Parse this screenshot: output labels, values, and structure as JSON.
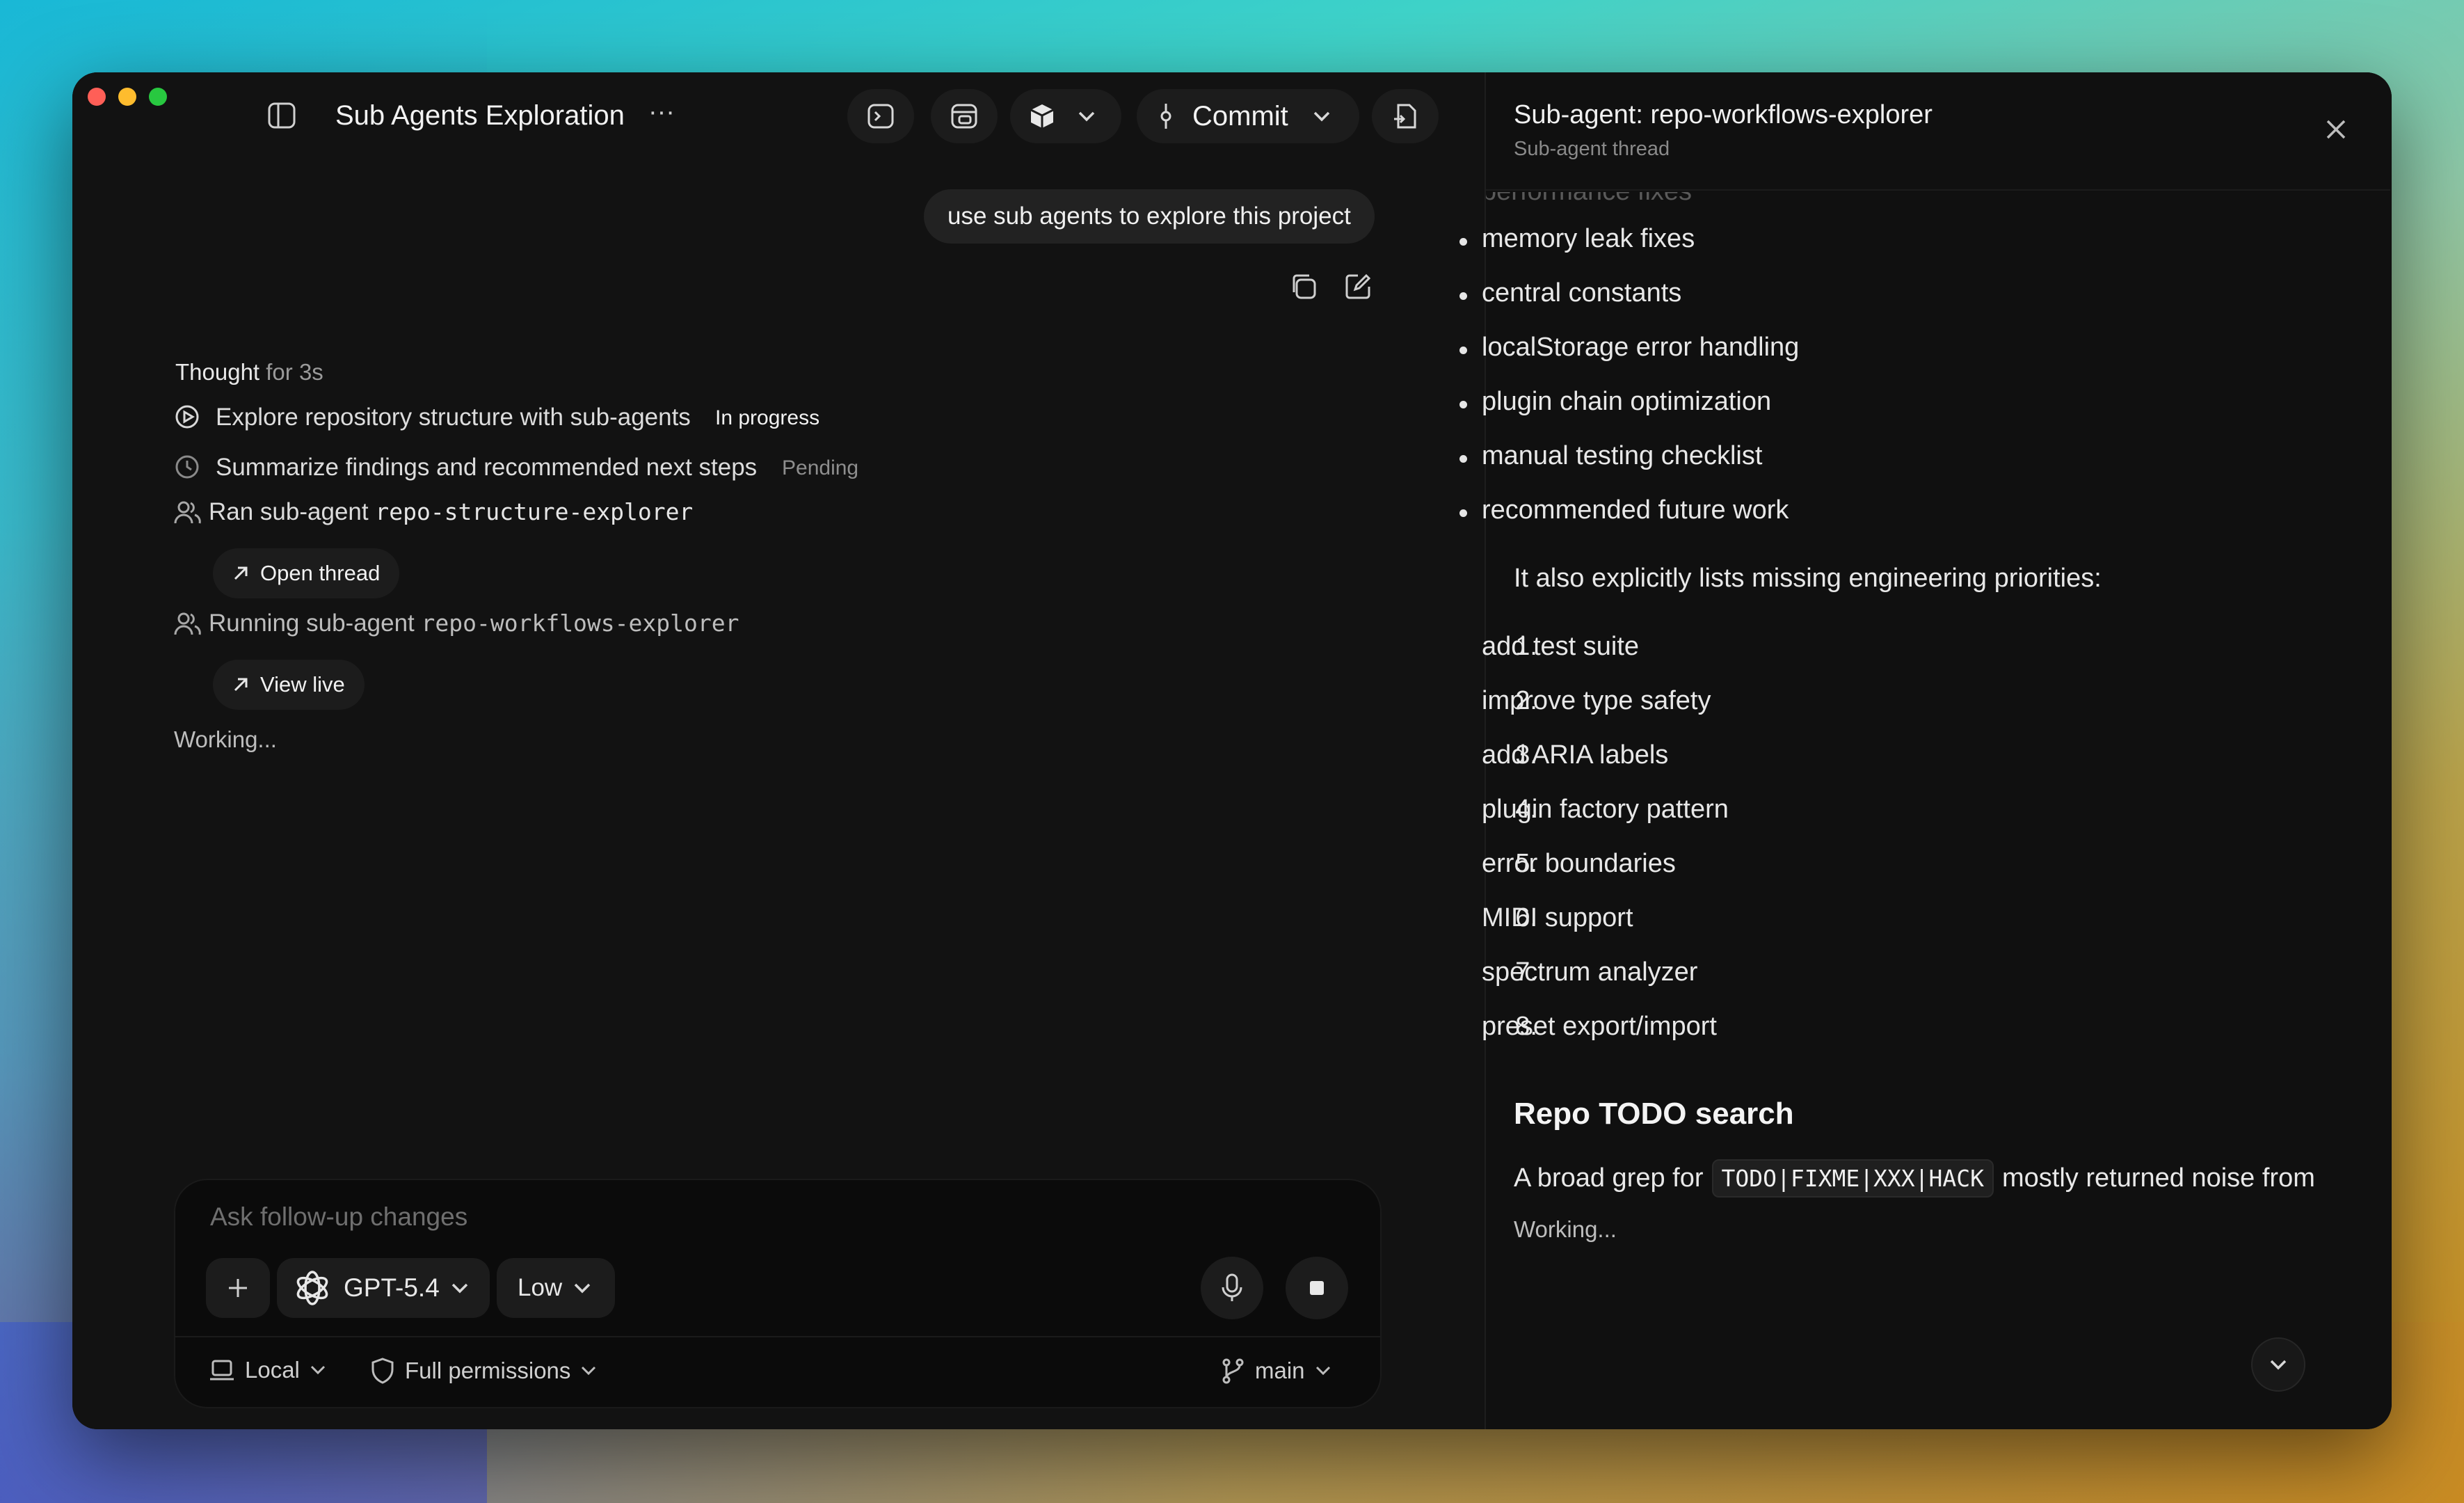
{
  "window": {
    "title": "Sub Agents Exploration",
    "more_label": "···"
  },
  "toolbar": {
    "commit_label": "Commit"
  },
  "chat": {
    "user_message": "use sub agents to explore this project",
    "thought": {
      "prefix": "Thought",
      "suffix": "for 3s"
    },
    "tasks": [
      {
        "label": "Explore repository structure with sub-agents",
        "status": "In progress"
      },
      {
        "label": "Summarize findings and recommended next steps",
        "status": "Pending"
      }
    ],
    "agent_runs": [
      {
        "prefix": "Ran sub-agent",
        "name": "repo-structure-explorer",
        "action": "Open thread"
      },
      {
        "prefix": "Running sub-agent",
        "name": "repo-workflows-explorer",
        "action": "View live"
      }
    ],
    "working": "Working..."
  },
  "composer": {
    "placeholder": "Ask follow-up changes",
    "model": "GPT-5.4",
    "effort": "Low",
    "location": "Local",
    "permissions": "Full permissions",
    "branch": "main"
  },
  "panel": {
    "title": "Sub-agent: repo-workflows-explorer",
    "subtitle": "Sub-agent thread",
    "faded_item": "performance fixes",
    "bullets": [
      "memory leak fixes",
      "central constants",
      "localStorage error handling",
      "plugin chain optimization",
      "manual testing checklist",
      "recommended future work"
    ],
    "priorities_intro": "It also explicitly lists missing engineering priorities:",
    "priorities": [
      "add test suite",
      "improve type safety",
      "add ARIA labels",
      "plugin factory pattern",
      "error boundaries",
      "MIDI support",
      "spectrum analyzer",
      "preset export/import"
    ],
    "section_heading": "Repo TODO search",
    "grep_before": "A broad grep for",
    "grep_code": "TODO|FIXME|XXX|HACK",
    "grep_after": "mostly returned noise from",
    "working": "Working..."
  },
  "colors": {
    "window_bg": "#111111",
    "traffic_red": "#ff5f57",
    "traffic_yellow": "#febc2e",
    "traffic_green": "#28c840"
  }
}
